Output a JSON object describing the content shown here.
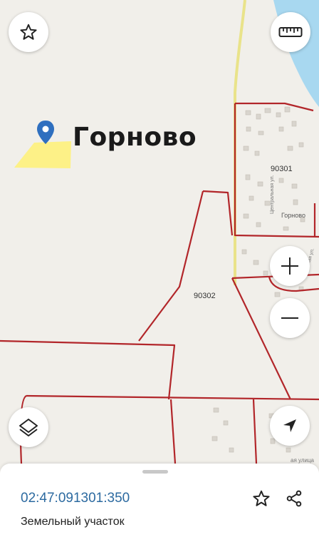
{
  "map": {
    "place_name": "Горново",
    "zones": [
      "90301",
      "90302"
    ],
    "settlement_label": "Горново",
    "street_labels": [
      "Центральная ул.",
      "Речная ул.",
      "ая улица"
    ],
    "colors": {
      "boundary": "#b2262a",
      "water": "#a8d8f0",
      "highlight": "#fff176",
      "pin": "#2f6fbf"
    }
  },
  "controls": {
    "favorite": "star-icon",
    "ruler": "ruler-icon",
    "zoom_in": "plus-icon",
    "zoom_out": "minus-icon",
    "layers": "layers-icon",
    "locate": "navigation-arrow-icon"
  },
  "sheet": {
    "cadastral_number": "02:47:091301:350",
    "object_type": "Земельный участок"
  }
}
